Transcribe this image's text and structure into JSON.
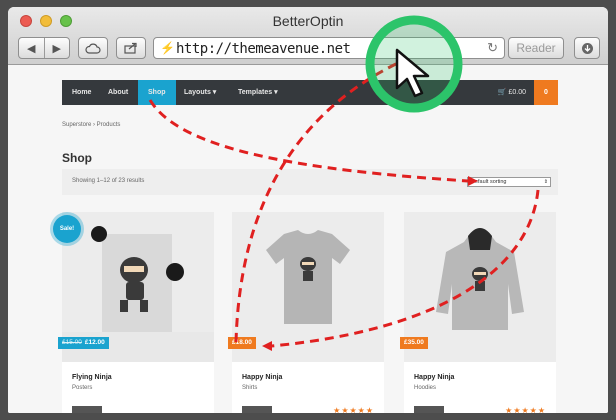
{
  "window": {
    "title": "BetterOptin",
    "url": "http://themeavenue.net",
    "reader_label": "Reader"
  },
  "navbar": {
    "items": [
      "Home",
      "About",
      "Shop",
      "Layouts",
      "Templates"
    ],
    "active": "Shop",
    "cart": "£0.00",
    "count": "0",
    "accent_color": "#1aa3cf",
    "cart_color": "#ef7a1f"
  },
  "breadcrumb": "Superstore  ›  Products",
  "shop": {
    "title": "Shop",
    "result_count": "Showing 1–12 of 23 results",
    "sort_value": "Default sorting"
  },
  "products": [
    {
      "name": "Flying Ninja",
      "category": "Posters",
      "old_price": "£15.00",
      "price": "£12.00",
      "sale": "Sale!",
      "icon": "poster-ninja"
    },
    {
      "name": "Happy Ninja",
      "category": "Shirts",
      "price": "£18.00",
      "icon": "tshirt-ninja"
    },
    {
      "name": "Happy Ninja",
      "category": "Hoodies",
      "price": "£35.00",
      "icon": "hoodie-ninja"
    }
  ],
  "overlay": {
    "highlight_color": "#2cc46a",
    "arrow_color": "#e02020",
    "icon": "mouse-cursor-icon"
  }
}
